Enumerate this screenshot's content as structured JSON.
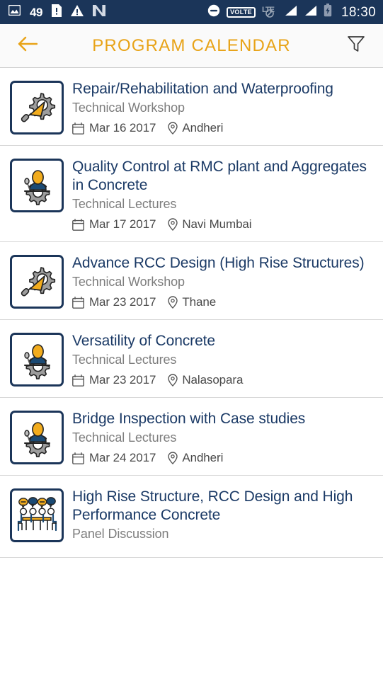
{
  "statusbar": {
    "photo_icon": "image-icon",
    "notification_count": "49",
    "sim_icon": "sim-alert-icon",
    "warning_icon": "warning-triangle-icon",
    "app_icon": "n-app-icon",
    "dnd_icon": "do-not-disturb-icon",
    "volte_label": "VOLTE",
    "lte_label": "LTE",
    "signal_icon": "signal-bars-icon",
    "battery_icon": "battery-charging-icon",
    "time": "18:30"
  },
  "appbar": {
    "back_icon": "arrow-left-icon",
    "title": "PROGRAM CALENDAR",
    "filter_icon": "filter-funnel-icon",
    "title_color": "#e8a317",
    "background": "#fafafa"
  },
  "theme": {
    "navy": "#1b3559",
    "title_blue": "#1b3a66",
    "amber": "#e8a317",
    "gear_gray": "#9d9d9d",
    "subtitle_gray": "#7d7d7d"
  },
  "events": [
    {
      "icon": "workshop-gear-trowel-icon",
      "title": "Repair/Rehabilitation and Waterproofing",
      "category": "Technical Workshop",
      "date": "Mar 16 2017",
      "location": "Andheri"
    },
    {
      "icon": "lecture-speaker-gear-icon",
      "title": "Quality Control at RMC plant and Aggregates in Concrete",
      "category": "Technical Lectures",
      "date": "Mar 17 2017",
      "location": "Navi Mumbai"
    },
    {
      "icon": "workshop-gear-trowel-icon",
      "title": "Advance RCC Design (High Rise Structures)",
      "category": "Technical Workshop",
      "date": "Mar 23 2017",
      "location": "Thane"
    },
    {
      "icon": "lecture-speaker-gear-icon",
      "title": "Versatility of Concrete",
      "category": "Technical Lectures",
      "date": "Mar 23 2017",
      "location": "Nalasopara"
    },
    {
      "icon": "lecture-speaker-gear-icon",
      "title": "Bridge Inspection with Case studies",
      "category": "Technical Lectures",
      "date": "Mar 24 2017",
      "location": "Andheri"
    },
    {
      "icon": "panel-discussion-table-icon",
      "title": "High Rise Structure, RCC Design and High Performance Concrete",
      "category": "Panel Discussion",
      "date": "",
      "location": ""
    }
  ]
}
